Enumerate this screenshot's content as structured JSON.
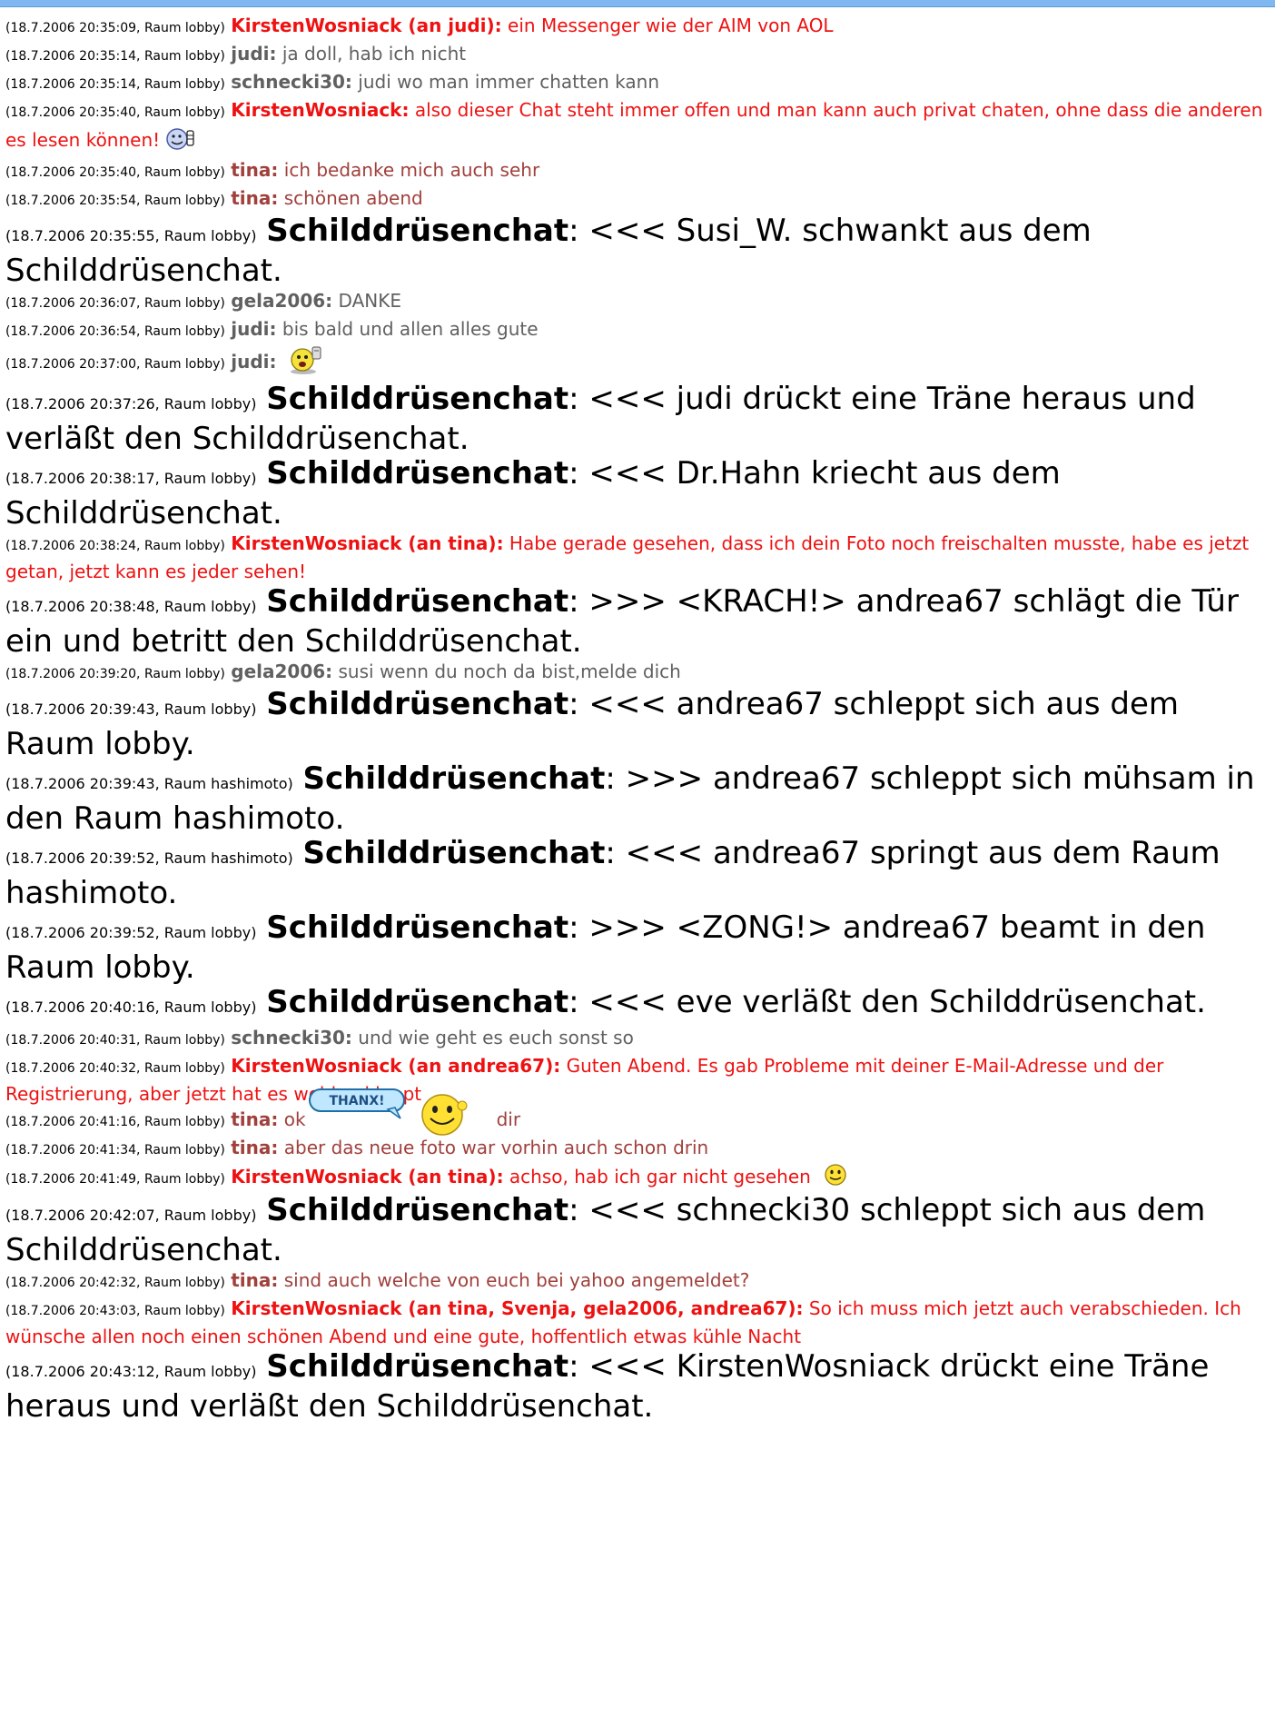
{
  "messages": [
    {
      "kind": "red",
      "ts": "(18.7.2006 20:35:09, Raum lobby)",
      "nick": "KirstenWosniack (an judi):",
      "text": "ein Messenger wie der AIM von AOL"
    },
    {
      "kind": "gray",
      "ts": "(18.7.2006 20:35:14, Raum lobby)",
      "nick": "judi:",
      "text": "ja doll, hab ich nicht"
    },
    {
      "kind": "gray",
      "ts": "(18.7.2006 20:35:14, Raum lobby)",
      "nick": "schnecki30:",
      "text": "judi wo man immer chatten kann"
    },
    {
      "kind": "red",
      "ts": "(18.7.2006 20:35:40, Raum lobby)",
      "nick": "KirstenWosniack:",
      "text": "also dieser Chat steht immer offen und man kann auch privat chaten, ohne dass die anderen es lesen können!",
      "icon": "thumbs-up-smiley-icon"
    },
    {
      "kind": "brown",
      "ts": "(18.7.2006 20:35:40, Raum lobby)",
      "nick": "tina:",
      "text": "ich bedanke mich auch sehr"
    },
    {
      "kind": "brown",
      "ts": "(18.7.2006 20:35:54, Raum lobby)",
      "nick": "tina:",
      "text": "schönen abend"
    },
    {
      "kind": "sys",
      "ts": "(18.7.2006 20:35:55, Raum lobby)",
      "nick": "Schilddrüsenchat",
      "text": "<<< Susi_W. schwankt aus dem Schilddrüsenchat."
    },
    {
      "kind": "gray",
      "ts": "(18.7.2006 20:36:07, Raum lobby)",
      "nick": "gela2006:",
      "text": "DANKE"
    },
    {
      "kind": "gray",
      "ts": "(18.7.2006 20:36:54, Raum lobby)",
      "nick": "judi:",
      "text": "bis bald und allen alles gute"
    },
    {
      "kind": "gray",
      "ts": "(18.7.2006 20:37:00, Raum lobby)",
      "nick": "judi:",
      "text": "",
      "icon": "waving-smiley-icon"
    },
    {
      "kind": "sys",
      "ts": "(18.7.2006 20:37:26, Raum lobby)",
      "nick": "Schilddrüsenchat",
      "text": "<<< judi drückt eine Träne heraus und verläßt den Schilddrüsenchat."
    },
    {
      "kind": "sys",
      "ts": "(18.7.2006 20:38:17, Raum lobby)",
      "nick": "Schilddrüsenchat",
      "text": "<<< Dr.Hahn kriecht aus dem Schilddrüsenchat."
    },
    {
      "kind": "red",
      "ts": "(18.7.2006 20:38:24, Raum lobby)",
      "nick": "KirstenWosniack (an tina):",
      "text": "Habe gerade gesehen, dass ich dein Foto noch freischalten musste, habe es jetzt getan, jetzt kann es jeder sehen!"
    },
    {
      "kind": "sys",
      "ts": "(18.7.2006 20:38:48, Raum lobby)",
      "nick": "Schilddrüsenchat",
      "text": ">>> <KRACH!> andrea67 schlägt die Tür ein und betritt den Schilddrüsenchat."
    },
    {
      "kind": "gray",
      "ts": "(18.7.2006 20:39:20, Raum lobby)",
      "nick": "gela2006:",
      "text": "susi wenn du noch da bist,melde dich"
    },
    {
      "kind": "sys",
      "ts": "(18.7.2006 20:39:43, Raum lobby)",
      "nick": "Schilddrüsenchat",
      "text": "<<< andrea67 schleppt sich aus dem Raum lobby."
    },
    {
      "kind": "sys",
      "ts": "(18.7.2006 20:39:43, Raum hashimoto)",
      "nick": "Schilddrüsenchat",
      "text": ">>> andrea67 schleppt sich mühsam in den Raum hashimoto."
    },
    {
      "kind": "sys",
      "ts": "(18.7.2006 20:39:52, Raum hashimoto)",
      "nick": "Schilddrüsenchat",
      "text": "<<< andrea67 springt aus dem Raum hashimoto."
    },
    {
      "kind": "sys",
      "ts": "(18.7.2006 20:39:52, Raum lobby)",
      "nick": "Schilddrüsenchat",
      "text": ">>> <ZONG!> andrea67 beamt in den Raum lobby."
    },
    {
      "kind": "sys",
      "ts": "(18.7.2006 20:40:16, Raum lobby)",
      "nick": "Schilddrüsenchat",
      "text": "<<< eve verläßt den Schilddrüsenchat."
    },
    {
      "kind": "gray",
      "ts": "(18.7.2006 20:40:31, Raum lobby)",
      "nick": "schnecki30:",
      "text": "und wie geht es euch sonst so"
    },
    {
      "kind": "red",
      "ts": "(18.7.2006 20:40:32, Raum lobby)",
      "nick": "KirstenWosniack (an andrea67):",
      "text": "Guten Abend. Es gab Probleme mit deiner E-Mail-Adresse und der Registrierung, aber jetzt hat es wohl geklappt"
    },
    {
      "kind": "brown",
      "ts": "(18.7.2006 20:41:16, Raum lobby)",
      "nick": "tina:",
      "text": "ok",
      "after": "dir",
      "icon": "thanx-smiley-icon",
      "thanx": "THANX!"
    },
    {
      "kind": "brown",
      "ts": "(18.7.2006 20:41:34, Raum lobby)",
      "nick": "tina:",
      "text": "aber das neue foto war vorhin auch schon drin"
    },
    {
      "kind": "red",
      "ts": "(18.7.2006 20:41:49, Raum lobby)",
      "nick": "KirstenWosniack (an tina):",
      "text": "achso, hab ich gar nicht gesehen",
      "icon": "smile-icon"
    },
    {
      "kind": "sys",
      "ts": "(18.7.2006 20:42:07, Raum lobby)",
      "nick": "Schilddrüsenchat",
      "text": "<<< schnecki30 schleppt sich aus dem Schilddrüsenchat."
    },
    {
      "kind": "brown",
      "ts": "(18.7.2006 20:42:32, Raum lobby)",
      "nick": "tina:",
      "text": "sind auch welche von euch bei yahoo angemeldet?"
    },
    {
      "kind": "red",
      "ts": "(18.7.2006 20:43:03, Raum lobby)",
      "nick": "KirstenWosniack (an tina, Svenja, gela2006, andrea67):",
      "text": "So ich muss mich jetzt auch verabschieden. Ich wünsche allen noch einen schönen Abend und eine gute, hoffentlich etwas kühle Nacht"
    },
    {
      "kind": "sys",
      "ts": "(18.7.2006 20:43:12, Raum lobby)",
      "nick": "Schilddrüsenchat",
      "text": "<<< KirstenWosniack drückt eine Träne heraus und verläßt den Schilddrüsenchat."
    }
  ],
  "colors": {
    "red": "#ee1111",
    "brown": "#a0403c",
    "gray": "#606060"
  }
}
